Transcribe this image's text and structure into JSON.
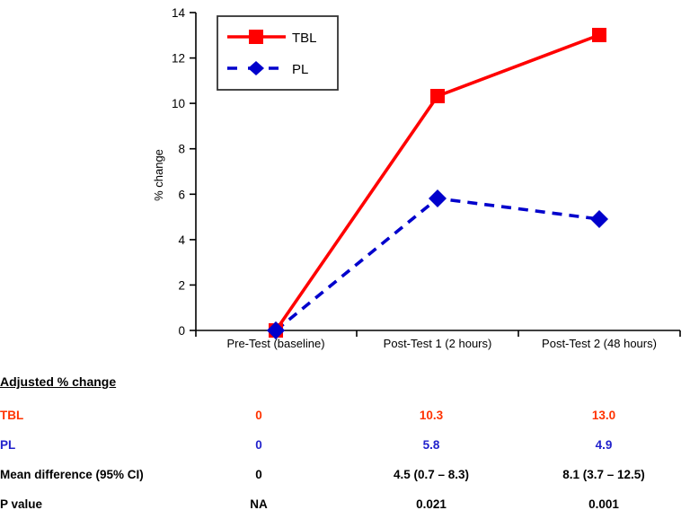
{
  "chart_data": {
    "type": "line",
    "title": "",
    "xlabel": "",
    "ylabel": "% change",
    "categories": [
      "Pre-Test (baseline)",
      "Post-Test 1 (2 hours)",
      "Post-Test 2 (48 hours)"
    ],
    "ylim": [
      0,
      14
    ],
    "yticks": [
      0,
      2,
      4,
      6,
      8,
      10,
      12,
      14
    ],
    "ytick_labels": [
      "0",
      "2",
      "4",
      "6",
      "8",
      "10",
      "12",
      "14"
    ],
    "grid": false,
    "legend_position": "top-left inside plot",
    "series": [
      {
        "name": "TBL",
        "values": [
          0,
          10.3,
          13.0
        ],
        "color": "#FF0000",
        "marker": "square",
        "line_style": "solid"
      },
      {
        "name": "PL",
        "values": [
          0,
          5.8,
          4.9
        ],
        "color": "#0000CC",
        "marker": "diamond",
        "line_style": "dashed"
      }
    ]
  },
  "legend": {
    "entries": [
      {
        "label": "TBL"
      },
      {
        "label": "PL"
      }
    ]
  },
  "table": {
    "section_title": "Adjusted % change",
    "rows": [
      {
        "label": "TBL",
        "style": "tbl",
        "values": [
          "0",
          "10.3",
          "13.0"
        ]
      },
      {
        "label": "PL",
        "style": "pl",
        "values": [
          "0",
          "5.8",
          "4.9"
        ]
      },
      {
        "label": "Mean difference (95% CI)",
        "style": "plain",
        "values": [
          "0",
          "4.5 (0.7 – 8.3)",
          "8.1 (3.7 – 12.5)"
        ]
      },
      {
        "label": "P value",
        "style": "plain",
        "values": [
          "NA",
          "0.021",
          "0.001"
        ]
      }
    ]
  },
  "colors": {
    "tbl_line": "#FF0000",
    "pl_line": "#0000CC",
    "tbl_text": "#FF3300",
    "pl_text": "#2222CC",
    "axis": "#000000"
  }
}
